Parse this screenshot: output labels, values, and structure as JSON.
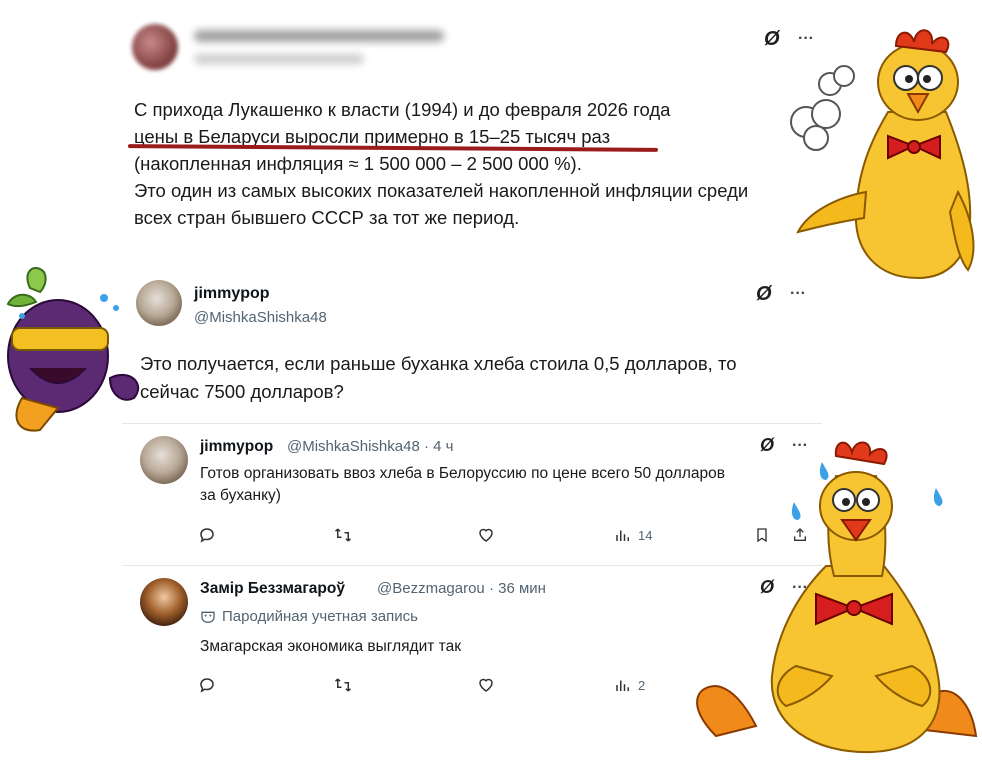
{
  "post1": {
    "lines": [
      "С прихода Лукашенко к власти (1994) и до февраля 2026 года",
      "цены в Беларуси выросли примерно в 15–25 тысяч раз",
      "(накопленная инфляция ≈ 1 500 000 – 2 500 000 %).",
      "Это один из самых высоких показателей накопленной инфляции среди",
      "всех стран бывшего СССР за тот же период."
    ]
  },
  "post2": {
    "name": "jimmypop",
    "handle": "@MishkaShishka48",
    "lines": [
      "Это получается, если раньше буханка хлеба стоила 0,5 долларов, то",
      "сейчас 7500 долларов?"
    ]
  },
  "reply1": {
    "name": "jimmypop",
    "handle": "@MishkaShishka48 · 4 ч",
    "lines": [
      "Готов организовать ввоз хлеба в Белоруссию по цене всего 50 долларов",
      "за буханку)"
    ],
    "views": "14"
  },
  "reply2": {
    "name": "Замір Беззмагароў",
    "handle": "@Bezzmagarou · 36 мин",
    "parody_label": "Пародийная учетная запись",
    "text": "Змагарская экономика выглядит так",
    "views": "2"
  },
  "colors": {
    "underline": "#9b1b1b",
    "chicken": "#f7c531",
    "bowtie": "#d71e1e",
    "plum": "#5b2a73"
  },
  "icons": [
    "grok-icon",
    "more-icon",
    "reply-icon",
    "repost-icon",
    "like-icon",
    "views-icon",
    "bookmark-icon",
    "share-icon",
    "parody-mask-icon"
  ]
}
